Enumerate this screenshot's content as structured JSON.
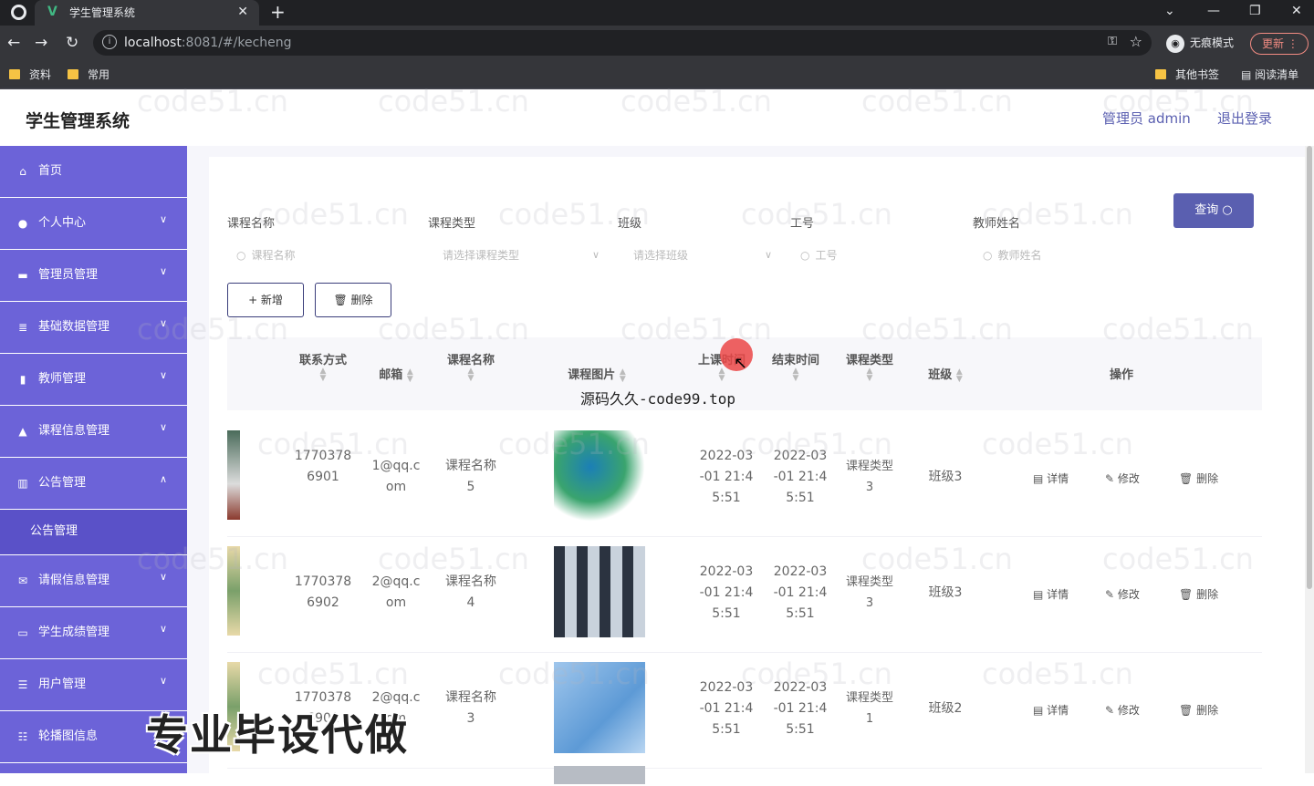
{
  "browser": {
    "tab_title": "学生管理系统",
    "url_host": "localhost",
    "url_rest": ":8081/#/kecheng",
    "incognito_label": "无痕模式",
    "update_label": "更新",
    "bookmarks": [
      "资料",
      "常用"
    ],
    "bookmarks_right": [
      "其他书签",
      "阅读清单"
    ]
  },
  "header": {
    "title": "学生管理系统",
    "admin_label": "管理员 admin",
    "logout_label": "退出登录"
  },
  "sidebar": {
    "items": [
      {
        "label": "首页",
        "icon": "home-icon",
        "chevron": ""
      },
      {
        "label": "个人中心",
        "icon": "user-icon",
        "chevron": "∨"
      },
      {
        "label": "管理员管理",
        "icon": "card-icon",
        "chevron": "∨"
      },
      {
        "label": "基础数据管理",
        "icon": "list-icon",
        "chevron": "∨"
      },
      {
        "label": "教师管理",
        "icon": "teacher-icon",
        "chevron": "∨"
      },
      {
        "label": "课程信息管理",
        "icon": "person-icon",
        "chevron": "∨"
      },
      {
        "label": "公告管理",
        "icon": "chart-icon",
        "chevron": "∧"
      }
    ],
    "sub_item": "公告管理",
    "items_after": [
      {
        "label": "请假信息管理",
        "icon": "mail-icon",
        "chevron": "∨"
      },
      {
        "label": "学生成绩管理",
        "icon": "screen-icon",
        "chevron": "∨"
      },
      {
        "label": "用户管理",
        "icon": "menu-icon",
        "chevron": "∨"
      },
      {
        "label": "轮播图信息",
        "icon": "sliders-icon",
        "chevron": ""
      }
    ]
  },
  "filters": {
    "course_name_label": "课程名称",
    "course_name_placeholder": "课程名称",
    "course_type_label": "课程类型",
    "course_type_placeholder": "请选择课程类型",
    "class_label": "班级",
    "class_placeholder": "请选择班级",
    "work_no_label": "工号",
    "work_no_placeholder": "工号",
    "teacher_label": "教师姓名",
    "teacher_placeholder": "教师姓名",
    "query_label": "查询"
  },
  "toolbar": {
    "add_label": "+ 新增",
    "delete_label": "删除"
  },
  "table": {
    "headers": {
      "phone": "联系方式",
      "email": "邮箱",
      "course_name": "课程名称",
      "course_image": "课程图片",
      "start_time": "上课时间",
      "end_time": "结束时间",
      "course_type": "课程类型",
      "class": "班级",
      "actions": "操作"
    },
    "rows": [
      {
        "phone1": "1770378",
        "phone2": "6901",
        "email1": "1@qq.c",
        "email2": "om",
        "name1": "课程名称",
        "name2": "5",
        "start1": "2022-03",
        "start2": "-01 21:4",
        "start3": "5:51",
        "end1": "2022-03",
        "end2": "-01 21:4",
        "end3": "5:51",
        "type1": "课程类型",
        "type2": "3",
        "class": "班级3"
      },
      {
        "phone1": "1770378",
        "phone2": "6902",
        "email1": "2@qq.c",
        "email2": "om",
        "name1": "课程名称",
        "name2": "4",
        "start1": "2022-03",
        "start2": "-01 21:4",
        "start3": "5:51",
        "end1": "2022-03",
        "end2": "-01 21:4",
        "end3": "5:51",
        "type1": "课程类型",
        "type2": "3",
        "class": "班级3"
      },
      {
        "phone1": "1770378",
        "phone2": "6902",
        "email1": "2@qq.c",
        "email2": "om",
        "name1": "课程名称",
        "name2": "3",
        "start1": "2022-03",
        "start2": "-01 21:4",
        "start3": "5:51",
        "end1": "2022-03",
        "end2": "-01 21:4",
        "end3": "5:51",
        "type1": "课程类型",
        "type2": "1",
        "class": "班级2"
      }
    ],
    "actions": {
      "detail": "详情",
      "edit": "修改",
      "delete": "删除"
    }
  },
  "overlays": {
    "watermark": "code51.cn",
    "source_text": "源码久久-code99.top",
    "stamp_text": "专业毕设代做"
  }
}
